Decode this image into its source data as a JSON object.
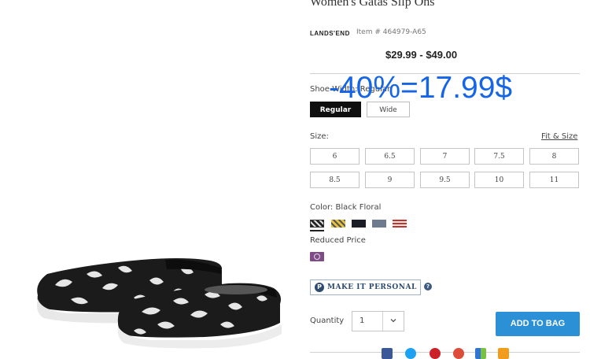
{
  "product": {
    "title": "Women's Gatas Slip Ons",
    "brand": "LANDS'END",
    "item_number": "Item # 464979-A65",
    "price_range": "$29.99 - $49.00"
  },
  "overlay": {
    "text": "-40%=17.99$",
    "color": "#1565e6"
  },
  "width": {
    "label": "Shoe Width: Regular",
    "options": [
      "Regular",
      "Wide"
    ],
    "selected": "Regular"
  },
  "size": {
    "label": "Size:",
    "fit_link": "Fit & Size",
    "options": [
      "6",
      "6.5",
      "7",
      "7.5",
      "8",
      "8.5",
      "9",
      "9.5",
      "10",
      "11"
    ]
  },
  "color": {
    "label": "Color: Black Floral",
    "selected": "Black Floral",
    "swatches": [
      "black-floral",
      "yellow-floral",
      "black",
      "slate-gray",
      "red-stripe"
    ]
  },
  "reduced": {
    "label": "Reduced Price",
    "swatches": [
      "purple-floral"
    ]
  },
  "personalize": {
    "label": "MAKE IT PERSONAL",
    "badge": "P",
    "help": "?"
  },
  "quantity": {
    "label": "Quantity",
    "value": "1"
  },
  "add_to_bag": "ADD TO BAG",
  "share_icons": [
    "facebook-icon",
    "twitter-icon",
    "pinterest-icon",
    "googleplus-icon",
    "delicious-icon",
    "email-icon"
  ],
  "colors": {
    "accent_button": "#2b90d6",
    "selected_width_bg": "#0f0f0f",
    "personal_badge": "#2f4b6e"
  }
}
